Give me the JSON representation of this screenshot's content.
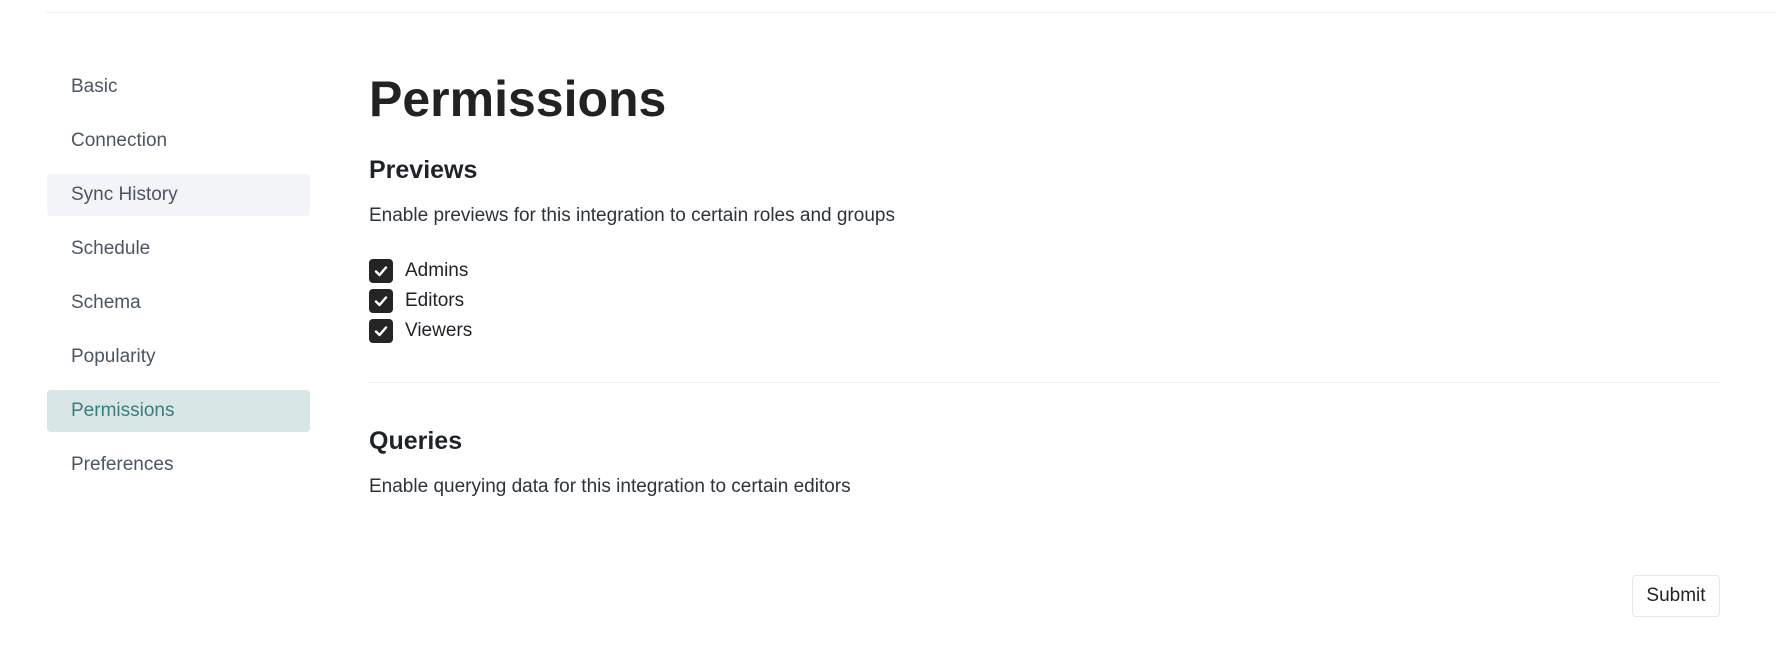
{
  "sidebar": {
    "items": [
      {
        "label": "Basic",
        "state": "default"
      },
      {
        "label": "Connection",
        "state": "default"
      },
      {
        "label": "Sync History",
        "state": "hover"
      },
      {
        "label": "Schedule",
        "state": "default"
      },
      {
        "label": "Schema",
        "state": "default"
      },
      {
        "label": "Popularity",
        "state": "default"
      },
      {
        "label": "Permissions",
        "state": "active"
      },
      {
        "label": "Preferences",
        "state": "default"
      }
    ]
  },
  "main": {
    "title": "Permissions",
    "previews": {
      "title": "Previews",
      "description": "Enable previews for this integration to certain roles and groups",
      "options": [
        {
          "label": "Admins",
          "checked": true
        },
        {
          "label": "Editors",
          "checked": true
        },
        {
          "label": "Viewers",
          "checked": true
        }
      ]
    },
    "queries": {
      "title": "Queries",
      "description": "Enable querying data for this integration to certain editors"
    },
    "submit_label": "Submit"
  },
  "colors": {
    "active_bg": "#d8e7e6",
    "active_text": "#3b7c7f",
    "hover_bg": "#f3f4f7",
    "checkbox_fill": "#242424"
  },
  "icons": {
    "checkbox": "checkmark-icon"
  }
}
